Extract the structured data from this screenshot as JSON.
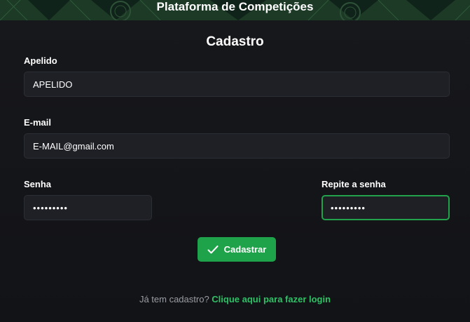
{
  "header": {
    "title": "Plataforma de Competições"
  },
  "form": {
    "title": "Cadastro",
    "nickname": {
      "label": "Apelido",
      "value": "APELIDO"
    },
    "email": {
      "label": "E-mail",
      "value": "E-MAIL@gmail.com"
    },
    "password": {
      "label": "Senha",
      "value": "•••••••••"
    },
    "confirm_password": {
      "label": "Repite a senha",
      "value": "•••••••••"
    },
    "submit_label": "Cadastrar",
    "footer_text": "Já tem cadastro?",
    "login_link": "Clique aqui para fazer login"
  },
  "colors": {
    "accent": "#1fa34a",
    "link": "#2fc166",
    "banner": "#1c3a25",
    "background": "#15161a"
  },
  "icons": {
    "submit": "check-icon"
  }
}
